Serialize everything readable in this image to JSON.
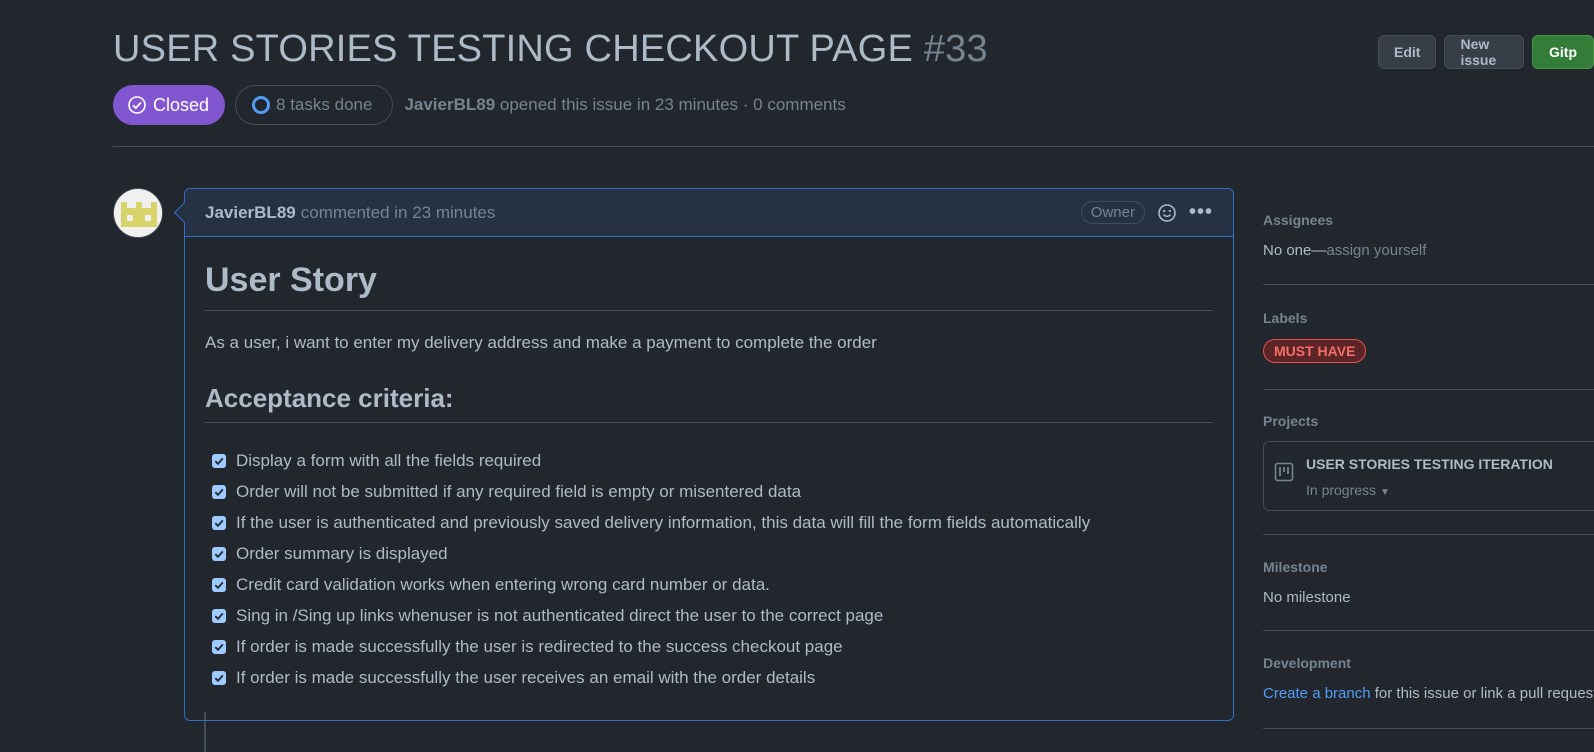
{
  "issue": {
    "title": "USER STORIES TESTING CHECKOUT PAGE",
    "number": "#33",
    "state": "Closed",
    "tasks": "8 tasks done",
    "author": "JavierBL89",
    "opened_text": " opened this issue in 23 minutes · 0 comments"
  },
  "header_buttons": {
    "edit": "Edit",
    "new_issue": "New issue",
    "gitpod": "Gitp"
  },
  "comment": {
    "author": "JavierBL89",
    "time_text": "commented in 23 minutes",
    "owner_badge": "Owner",
    "heading": "User Story",
    "story": "As a user, i want to enter my delivery address and make a payment to complete the order",
    "criteria_heading": "Acceptance criteria:",
    "tasks": [
      {
        "text": "Display a form with all the fields required",
        "checked": true
      },
      {
        "text": "Order will not be submitted if any required field is empty or misentered data",
        "checked": true
      },
      {
        "text": "If the user is authenticated and previously saved delivery information, this data will fill the form fields automatically",
        "checked": true
      },
      {
        "text": "Order summary is displayed",
        "checked": true
      },
      {
        "text": "Credit card validation works when entering wrong card number or data.",
        "checked": true
      },
      {
        "text": "Sing in /Sing up links whenuser is not authenticated direct the user to the correct page",
        "checked": true
      },
      {
        "text": "If order is made successfully the user is redirected to the success checkout page",
        "checked": true
      },
      {
        "text": "If order is made successfully the user receives an email with the order details",
        "checked": true
      }
    ]
  },
  "sidebar": {
    "assignees": {
      "label": "Assignees",
      "value": "No one—",
      "action": "assign yourself"
    },
    "labels": {
      "label": "Labels",
      "tag": "MUST HAVE",
      "tag_color": "#f47067"
    },
    "projects": {
      "label": "Projects",
      "name": "USER STORIES TESTING ITERATION",
      "status": "In progress"
    },
    "milestone": {
      "label": "Milestone",
      "value": "No milestone"
    },
    "development": {
      "label": "Development",
      "link": "Create a branch",
      "text": " for this issue or link a pull request"
    }
  },
  "colors": {
    "closed_purple": "#8256d0",
    "accent_blue": "#539bf5",
    "background": "#22272e"
  }
}
